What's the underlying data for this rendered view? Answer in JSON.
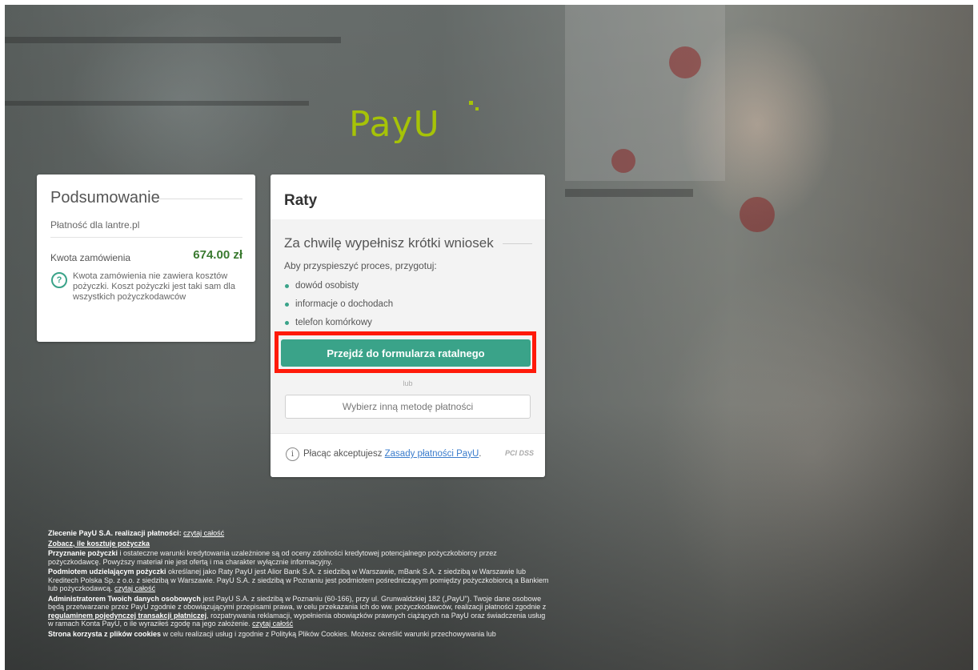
{
  "brand": {
    "logo_text": "PayU",
    "accent": "#a6c307",
    "button_color": "#3aa389",
    "highlight_color": "#ff1a0a"
  },
  "summary": {
    "title": "Podsumowanie",
    "merchant": "Płatność dla lantre.pl",
    "amount_label": "Kwota zamówienia",
    "amount": "674.00 zł",
    "help_icon": "question-circle-icon",
    "note": "Kwota zamówienia nie zawiera kosztów pożyczki. Koszt pożyczki jest taki sam dla wszystkich pożyczkodawców"
  },
  "main": {
    "title": "Raty",
    "subtitle": "Za chwilę wypełnisz krótki wniosek",
    "prep_text": "Aby przyspieszyć proces, przygotuj:",
    "items": [
      "dowód osobisty",
      "informacje o dochodach",
      "telefon komórkowy"
    ],
    "submit_label": "Przejdź do formularza ratalnego",
    "or_label": "lub",
    "other_method_label": "Wybierz inną metodę płatności",
    "accept_prefix": "Płacąc akceptujesz ",
    "accept_link": "Zasady płatności PayU",
    "accept_suffix": ".",
    "pci_badge": "PCI DSS"
  },
  "legal": {
    "p1_bold": "Zlecenie PayU S.A. realizacji płatności:",
    "p1_link": "czytaj całość",
    "p2_link": "Zobacz, ile kosztuje pożyczka",
    "p3_bold": "Przyznanie pożyczki",
    "p3_text": " i ostateczne warunki kredytowania uzależnione są od oceny zdolności kredytowej potencjalnego pożyczkobiorcy przez pożyczkodawcę. Powyższy materiał nie jest ofertą i ma charakter wyłącznie informacyjny.",
    "p4_bold": "Podmiotem udzielającym pożyczki",
    "p4_text": " określanej jako Raty PayU jest Alior Bank S.A. z siedzibą w Warszawie, mBank S.A. z siedzibą w Warszawie lub Kreditech Polska Sp. z o.o. z siedzibą w Warszawie. PayU S.A. z siedzibą w Poznaniu jest podmiotem pośredniczącym pomiędzy pożyczkobiorcą a Bankiem lub pożyczkodawcą. ",
    "p4_link": "czytaj całość",
    "p5_bold": "Administratorem Twoich danych osobowych",
    "p5_text": " jest PayU S.A. z siedzibą w Poznaniu (60-166), przy ul. Grunwaldzkiej 182 („PayU\"). Twoje dane osobowe będą przetwarzane przez PayU zgodnie z obowiązującymi przepisami prawa, w celu przekazania ich do ww. pożyczkodawców, realizacji płatności zgodnie z ",
    "p5_link_bold": "regulaminem pojedynczej transakcji płatniczej",
    "p5_text2": ", rozpatrywania reklamacji, wypełnienia obowiązków prawnych ciążących na PayU oraz świadczenia usług w ramach Konta PayU, o ile wyraziłeś zgodę na jego założenie. ",
    "p5_link": "czytaj całość",
    "p6_bold": "Strona korzysta z plików cookies",
    "p6_text": " w celu realizacji usług i zgodnie z Polityką Plików Cookies. Możesz określić warunki przechowywania lub"
  }
}
